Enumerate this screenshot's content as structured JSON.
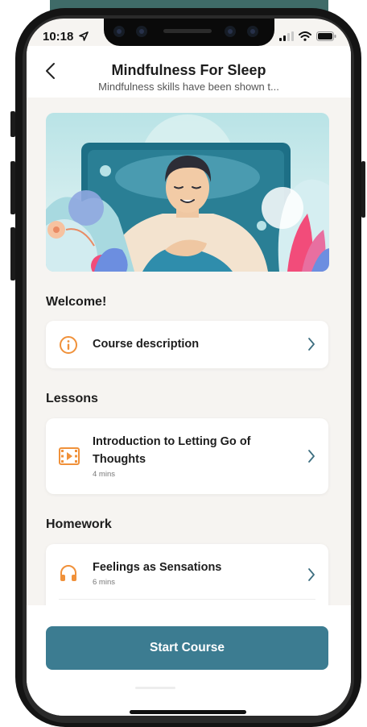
{
  "status": {
    "time": "10:18"
  },
  "header": {
    "title": "Mindfulness For Sleep",
    "subtitle": "Mindfulness skills have been shown t..."
  },
  "sections": {
    "welcome": "Welcome!",
    "lessons": "Lessons",
    "homework": "Homework"
  },
  "welcome_card": {
    "label": "Course description"
  },
  "lesson_card": {
    "label_line1": "Introduction to Letting Go of",
    "label_line2": "Thoughts",
    "meta": "4 mins"
  },
  "homework_card": {
    "label": "Feelings as Sensations",
    "meta": "6 mins"
  },
  "cta": {
    "label": "Start Course"
  },
  "colors": {
    "accent": "#3c7c91",
    "icon_orange": "#f0913a",
    "chevron": "#3d6e80"
  },
  "icons": [
    "back-chevron-icon",
    "location-arrow-icon",
    "signal-icon",
    "wifi-icon",
    "battery-icon",
    "info-icon",
    "video-play-icon",
    "headphones-icon",
    "chevron-right-icon"
  ]
}
